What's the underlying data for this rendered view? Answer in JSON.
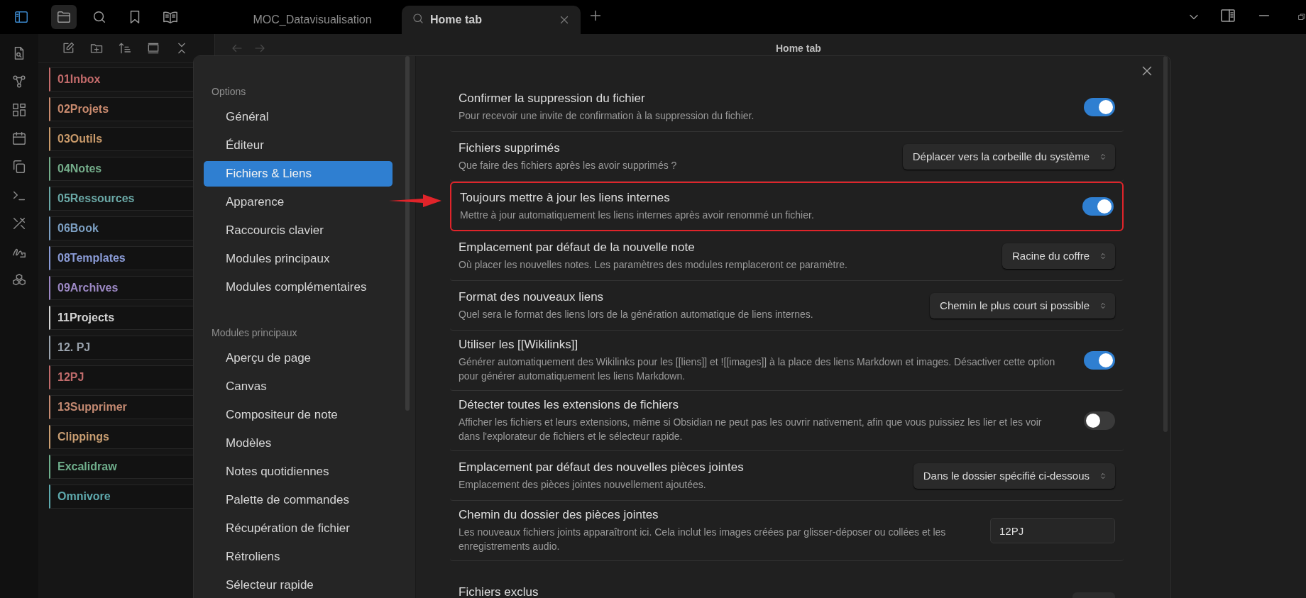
{
  "top_bar": {
    "tabs": [
      {
        "label": "MOC_Datavisualisation",
        "selected": false
      },
      {
        "label": "Home tab",
        "selected": true
      }
    ]
  },
  "file_explorer": {
    "folders": [
      {
        "name": "01Inbox",
        "color": "#c46b6b"
      },
      {
        "name": "02Projets",
        "color": "#c98a6e"
      },
      {
        "name": "03Outils",
        "color": "#c99a6a"
      },
      {
        "name": "04Notes",
        "color": "#74ad8a"
      },
      {
        "name": "05Ressources",
        "color": "#6aa8a6"
      },
      {
        "name": "06Book",
        "color": "#7c9fc2"
      },
      {
        "name": "08Templates",
        "color": "#8a9bd6"
      },
      {
        "name": "09Archives",
        "color": "#9c88c4"
      },
      {
        "name": "11Projects",
        "color": "#d4d4d4"
      },
      {
        "name": "12. PJ",
        "color": "#9aa3ad"
      },
      {
        "name": "12PJ",
        "color": "#c06b6b"
      },
      {
        "name": "13Supprimer",
        "color": "#c48a72"
      },
      {
        "name": "Clippings",
        "color": "#c99e72"
      },
      {
        "name": "Excalidraw",
        "color": "#6fae8c"
      },
      {
        "name": "Omnivore",
        "color": "#5ea9ad"
      }
    ]
  },
  "view_header": {
    "title": "Home tab"
  },
  "settings": {
    "nav_sections": [
      {
        "heading": "Options",
        "items": [
          {
            "label": "Général",
            "selected": false
          },
          {
            "label": "Éditeur",
            "selected": false
          },
          {
            "label": "Fichiers & Liens",
            "selected": true
          },
          {
            "label": "Apparence",
            "selected": false
          },
          {
            "label": "Raccourcis clavier",
            "selected": false
          },
          {
            "label": "Modules principaux",
            "selected": false
          },
          {
            "label": "Modules complémentaires",
            "selected": false
          }
        ]
      },
      {
        "heading": "Modules principaux",
        "items": [
          {
            "label": "Aperçu de page",
            "selected": false
          },
          {
            "label": "Canvas",
            "selected": false
          },
          {
            "label": "Compositeur de note",
            "selected": false
          },
          {
            "label": "Modèles",
            "selected": false
          },
          {
            "label": "Notes quotidiennes",
            "selected": false
          },
          {
            "label": "Palette de commandes",
            "selected": false
          },
          {
            "label": "Récupération de fichier",
            "selected": false
          },
          {
            "label": "Rétroliens",
            "selected": false
          },
          {
            "label": "Sélecteur rapide",
            "selected": false
          }
        ]
      }
    ],
    "rows": [
      {
        "title": "Confirmer la suppression du fichier",
        "description": "Pour recevoir une invite de confirmation à la suppression du fichier.",
        "kind": "toggle",
        "on": true,
        "highlighted": false
      },
      {
        "title": "Fichiers supprimés",
        "description": "Que faire des fichiers après les avoir supprimés ?",
        "kind": "dropdown",
        "value": "Déplacer vers la corbeille du système",
        "highlighted": false
      },
      {
        "title": "Toujours mettre à jour les liens internes",
        "description": "Mettre à jour automatiquement les liens internes après avoir renommé un fichier.",
        "kind": "toggle",
        "on": true,
        "highlighted": true
      },
      {
        "title": "Emplacement par défaut de la nouvelle note",
        "description": "Où placer les nouvelles notes. Les paramètres des modules remplaceront ce paramètre.",
        "kind": "dropdown",
        "value": "Racine du coffre",
        "highlighted": false
      },
      {
        "title": "Format des nouveaux liens",
        "description": "Quel sera le format des liens lors de la génération automatique de liens internes.",
        "kind": "dropdown",
        "value": "Chemin le plus court si possible",
        "highlighted": false
      },
      {
        "title": "Utiliser les [[Wikilinks]]",
        "description": "Générer automatiquement des Wikilinks pour les [[liens]] et ![[images]] à la place des liens Markdown et images. Désactiver cette option pour générer automatiquement les liens Markdown.",
        "kind": "toggle",
        "on": true,
        "highlighted": false
      },
      {
        "title": "Détecter toutes les extensions de fichiers",
        "description": "Afficher les fichiers et leurs extensions, même si Obsidian ne peut pas les ouvrir nativement, afin que vous puissiez les lier et les voir dans l'explorateur de fichiers et le sélecteur rapide.",
        "kind": "toggle",
        "on": false,
        "highlighted": false
      },
      {
        "title": "Emplacement par défaut des nouvelles pièces jointes",
        "description": "Emplacement des pièces jointes nouvellement ajoutées.",
        "kind": "dropdown",
        "value": "Dans le dossier spécifié ci-dessous",
        "highlighted": false
      },
      {
        "title": "Chemin du dossier des pièces jointes",
        "description": "Les nouveaux fichiers joints apparaîtront ici. Cela inclut les images créées par glisser-déposer ou collées et les enregistrements audio.",
        "kind": "text",
        "value": "12PJ",
        "highlighted": false
      },
      {
        "title": "Fichiers exclus",
        "kind": "button",
        "highlighted": false
      }
    ]
  }
}
